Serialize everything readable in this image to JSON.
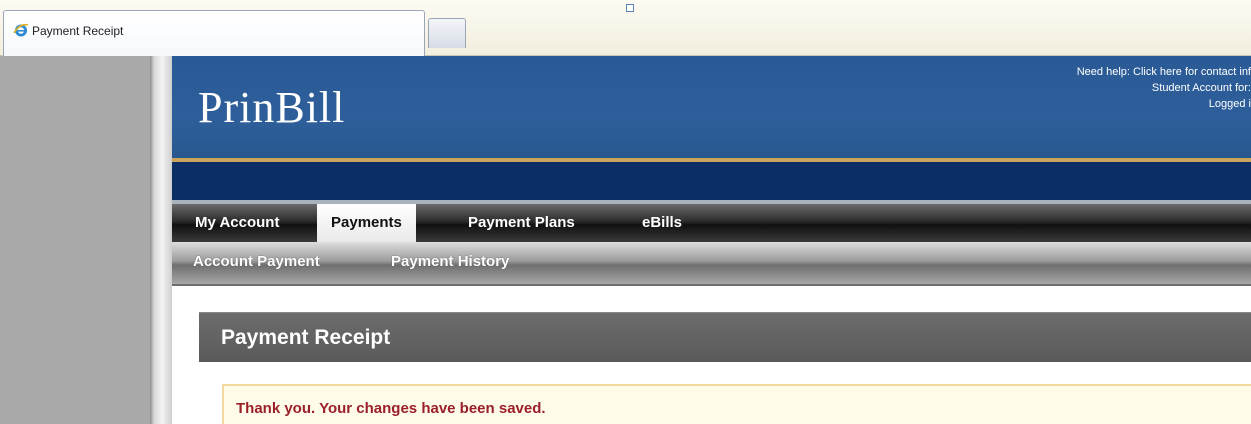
{
  "browser": {
    "tab_title": "Payment Receipt",
    "icons": {
      "tab_icon": "ie-icon"
    }
  },
  "header": {
    "logo": "PrinBill",
    "help_link": "Need help: Click here for contact inf",
    "student_account": "Student Account for:",
    "logged": "Logged i"
  },
  "nav": {
    "items": [
      {
        "label": "My Account",
        "active": false
      },
      {
        "label": "Payments",
        "active": true
      },
      {
        "label": "Payment Plans",
        "active": false
      },
      {
        "label": "eBills",
        "active": false
      }
    ],
    "sub_items": [
      {
        "label": "Account Payment"
      },
      {
        "label": "Payment History"
      }
    ]
  },
  "content": {
    "title": "Payment Receipt",
    "notice": "Thank you. Your changes have been saved."
  },
  "colors": {
    "header_blue": "#2e5f9b",
    "gold_accent": "#c9a45a",
    "navy": "#0b2e66",
    "notice_text": "#9a1f2a"
  }
}
